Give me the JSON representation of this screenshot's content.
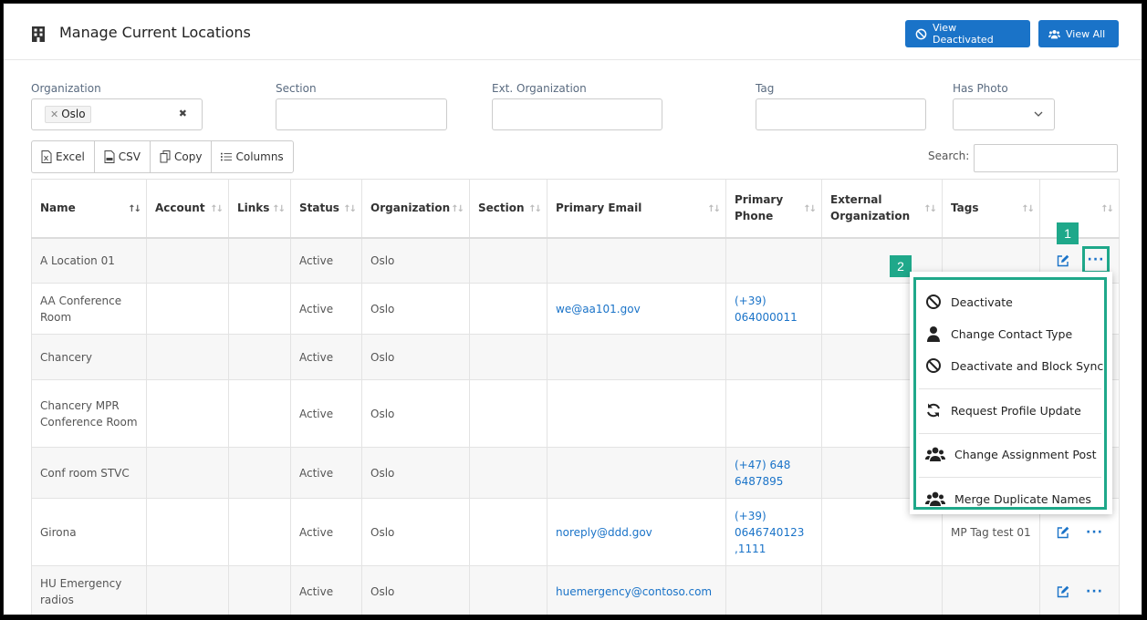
{
  "header": {
    "title": "Manage Current Locations",
    "view_deactivated": "View Deactivated",
    "view_all": "View All"
  },
  "filters": {
    "organization_label": "Organization",
    "organization_chip": "Oslo",
    "section_label": "Section",
    "ext_org_label": "Ext. Organization",
    "tag_label": "Tag",
    "has_photo_label": "Has Photo"
  },
  "toolbar": {
    "excel": "Excel",
    "csv": "CSV",
    "copy": "Copy",
    "columns": "Columns",
    "search_label": "Search:"
  },
  "columns": [
    "Name",
    "Account",
    "Links",
    "Status",
    "Organization",
    "Section",
    "Primary Email",
    "Primary Phone",
    "External Organization",
    "Tags"
  ],
  "rows": [
    {
      "name": "A Location 01",
      "status": "Active",
      "org": "Oslo",
      "email": "",
      "phone": "",
      "tags": ""
    },
    {
      "name": "AA Conference Room",
      "status": "Active",
      "org": "Oslo",
      "email": "we@aa101.gov",
      "phone": "(+39) 064000011",
      "tags": ""
    },
    {
      "name": "Chancery",
      "status": "Active",
      "org": "Oslo",
      "email": "",
      "phone": "",
      "tags": ""
    },
    {
      "name": "Chancery MPR Conference Room",
      "status": "Active",
      "org": "Oslo",
      "email": "",
      "phone": "",
      "tags": ""
    },
    {
      "name": "Conf room STVC",
      "status": "Active",
      "org": "Oslo",
      "email": "",
      "phone": "(+47) 648 6487895",
      "tags": ""
    },
    {
      "name": "Girona",
      "status": "Active",
      "org": "Oslo",
      "email": "noreply@ddd.gov",
      "phone": "(+39) 0646740123 ,1111",
      "tags": "MP Tag test 01"
    },
    {
      "name": "HU Emergency radios",
      "status": "Active",
      "org": "Oslo",
      "email": "huemergency@contoso.com",
      "phone": "",
      "tags": ""
    }
  ],
  "menu": {
    "deactivate": "Deactivate",
    "change_contact_type": "Change Contact Type",
    "deactivate_block": "Deactivate and Block Sync",
    "request_profile": "Request Profile Update",
    "change_assignment": "Change Assignment Post",
    "merge_duplicate": "Merge Duplicate Names"
  },
  "badges": {
    "one": "1",
    "two": "2"
  },
  "colors": {
    "primary": "#1a73c8",
    "highlight": "#1fa88a"
  }
}
